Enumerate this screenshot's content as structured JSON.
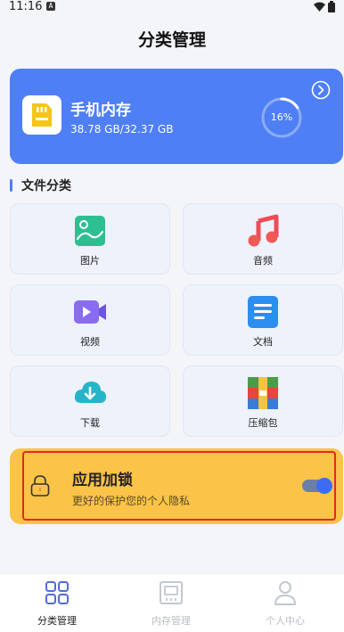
{
  "status": {
    "time": "11:16",
    "sim_label": "A"
  },
  "header": {
    "title": "分类管理"
  },
  "storage": {
    "name": "手机内存",
    "size_text": "38.78 GB/32.37 GB",
    "percent_text": "16%",
    "percent": 0.16
  },
  "section": {
    "title": "文件分类"
  },
  "categories": [
    {
      "label": "图片",
      "icon": "image-icon"
    },
    {
      "label": "音频",
      "icon": "music-note-icon"
    },
    {
      "label": "视频",
      "icon": "video-icon"
    },
    {
      "label": "文档",
      "icon": "document-icon"
    },
    {
      "label": "下载",
      "icon": "cloud-download-icon"
    },
    {
      "label": "压缩包",
      "icon": "archive-icon"
    }
  ],
  "app_lock": {
    "title": "应用加锁",
    "subtitle": "更好的保护您的个人隐私",
    "enabled": true
  },
  "tabs": [
    {
      "label": "分类管理",
      "active": true
    },
    {
      "label": "内存管理",
      "active": false
    },
    {
      "label": "个人中心",
      "active": false
    }
  ],
  "colors": {
    "accent": "#4f7ff5",
    "lock_card": "#fbc348",
    "highlight_border": "#e0282b"
  }
}
